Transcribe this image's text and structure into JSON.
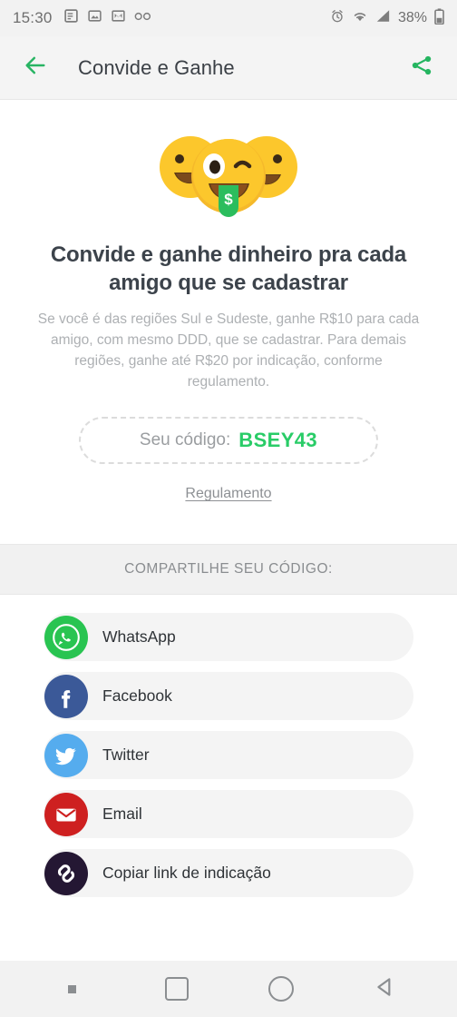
{
  "status_bar": {
    "time": "15:30",
    "battery": "38%",
    "left_icons": [
      "article-icon",
      "image-icon",
      "gmail-icon",
      "voicemail-icon"
    ],
    "right_icons": [
      "alarm-icon",
      "wifi-icon",
      "signal-icon",
      "battery-icon"
    ]
  },
  "app_bar": {
    "back_icon": "arrow-left-icon",
    "title": "Convide e Ganhe",
    "share_icon": "share-icon",
    "accent_color": "#29b765"
  },
  "hero": {
    "emoji": "three-smiling-faces-money-tongue",
    "headline": "Convide e ganhe dinheiro pra cada amigo que se cadastrar",
    "subtext": "Se você é das regiões Sul e Sudeste, ganhe R$10 para cada amigo, com mesmo DDD, que se cadastrar. Para demais regiões, ganhe até R$20 por indicação, conforme regulamento.",
    "code_label": "Seu código:",
    "code_value": "BSEY43",
    "code_color": "#29cc67",
    "rules_link": "Regulamento"
  },
  "share": {
    "section_title": "COMPARTILHE SEU CÓDIGO:",
    "options": [
      {
        "label": "WhatsApp",
        "icon": "whatsapp-icon",
        "color": "#29c451"
      },
      {
        "label": "Facebook",
        "icon": "facebook-icon",
        "color": "#3b5998"
      },
      {
        "label": "Twitter",
        "icon": "twitter-icon",
        "color": "#55acee"
      },
      {
        "label": "Email",
        "icon": "email-icon",
        "color": "#ce2020"
      },
      {
        "label": "Copiar link de indicação",
        "icon": "link-icon",
        "color": "#241733"
      }
    ]
  },
  "nav_bar": {
    "dot_icon": "dot-indicator",
    "recents_icon": "square-recents-icon",
    "home_icon": "circle-home-icon",
    "back_icon": "triangle-back-icon"
  }
}
